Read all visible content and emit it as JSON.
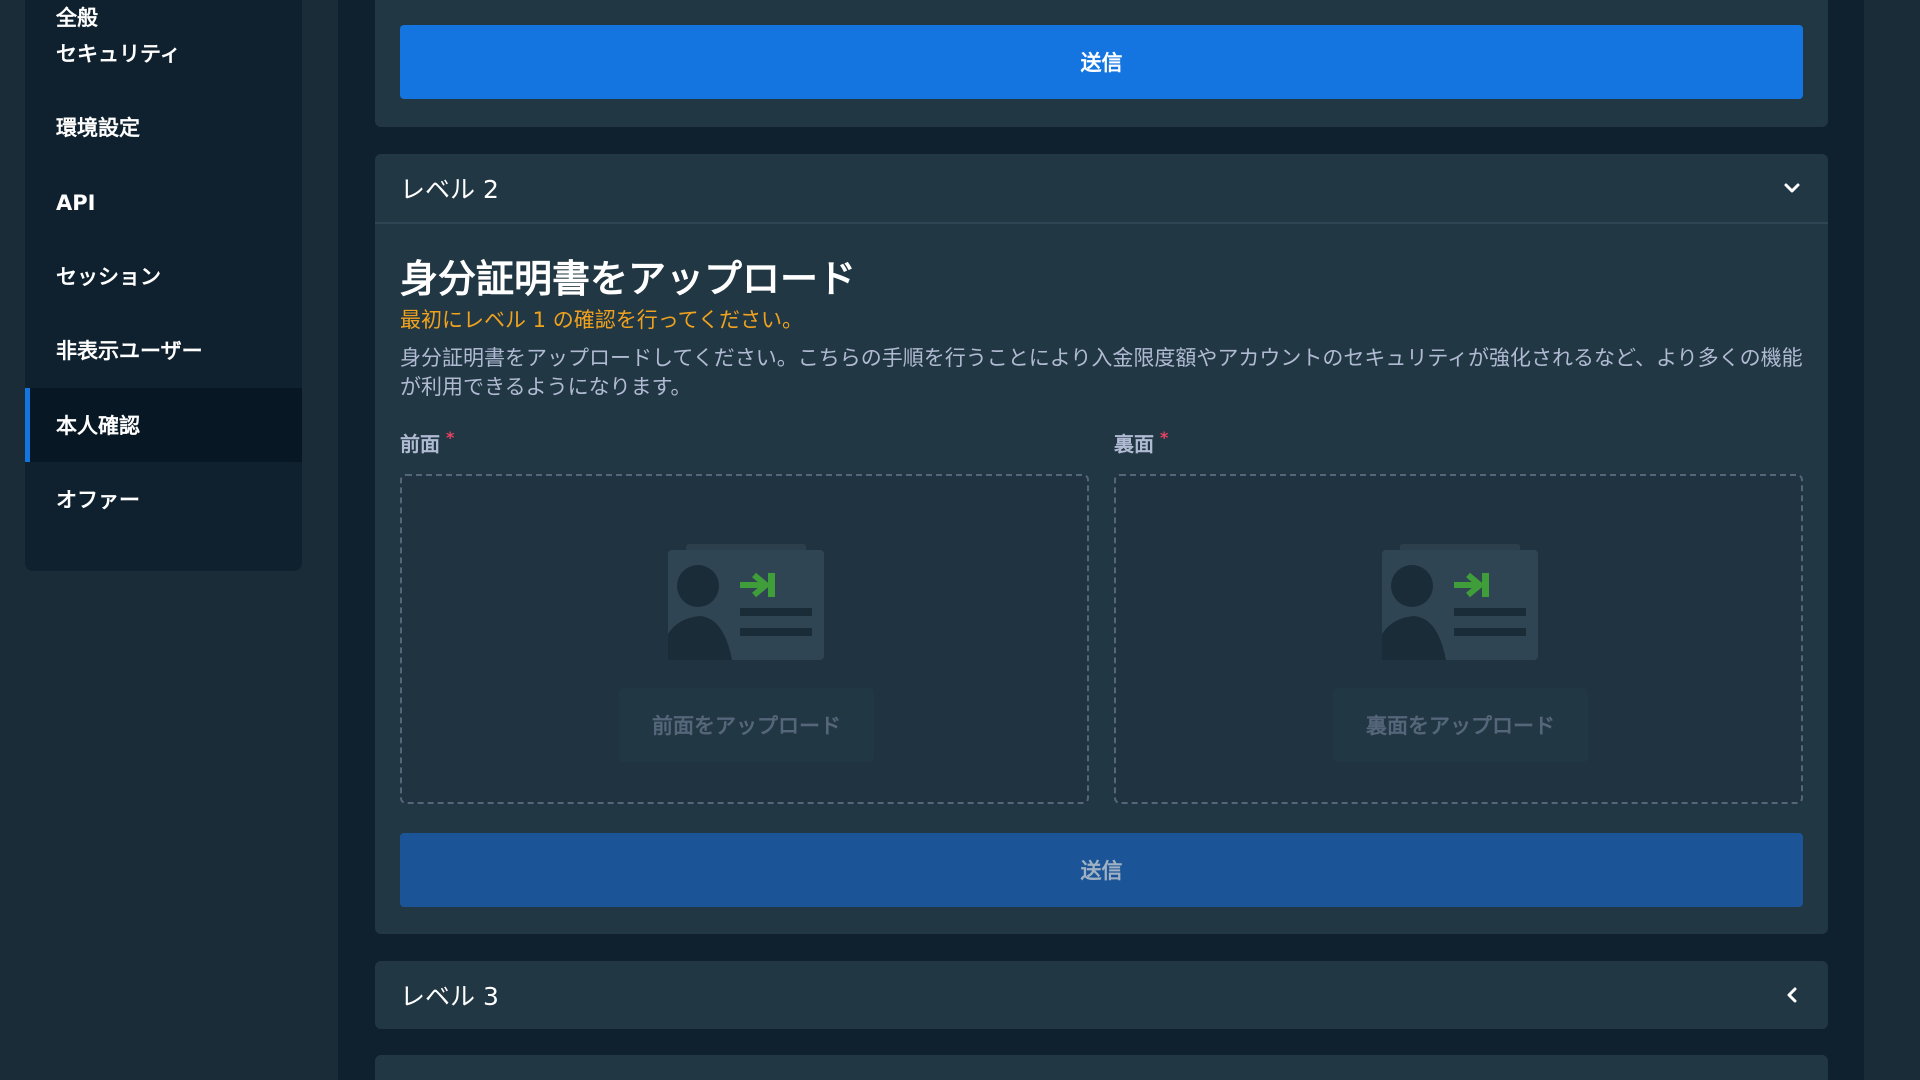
{
  "sidebar": {
    "items": [
      {
        "label": "全般"
      },
      {
        "label": "セキュリティ"
      },
      {
        "label": "環境設定"
      },
      {
        "label": "API"
      },
      {
        "label": "セッション"
      },
      {
        "label": "非表示ユーザー"
      },
      {
        "label": "本人確認",
        "active": true
      },
      {
        "label": "オファー"
      }
    ]
  },
  "level1": {
    "submit_label": "送信"
  },
  "level2": {
    "title": "レベル 2",
    "expanded": true,
    "upload_heading": "身分証明書をアップロード",
    "warning": "最初にレベル 1 の確認を行ってください。",
    "description": "身分証明書をアップロードしてください。こちらの手順を行うことにより入金限度額やアカウントのセキュリティが強化されるなど、より多くの機能が利用できるようになります。",
    "front": {
      "label": "前面",
      "required_mark": "*",
      "button": "前面をアップロード"
    },
    "back": {
      "label": "裏面",
      "required_mark": "*",
      "button": "裏面をアップロード"
    },
    "submit_label": "送信"
  },
  "level3": {
    "title": "レベル 3",
    "expanded": false
  },
  "colors": {
    "accent": "#1475e1",
    "warning": "#f0a21f",
    "required": "#ed4163",
    "icon_green": "#3f9e3a"
  },
  "icons": {
    "chevron_expanded": "chevron-down-icon",
    "chevron_collapsed": "chevron-left-icon",
    "id_card": "id-card-upload-icon"
  }
}
